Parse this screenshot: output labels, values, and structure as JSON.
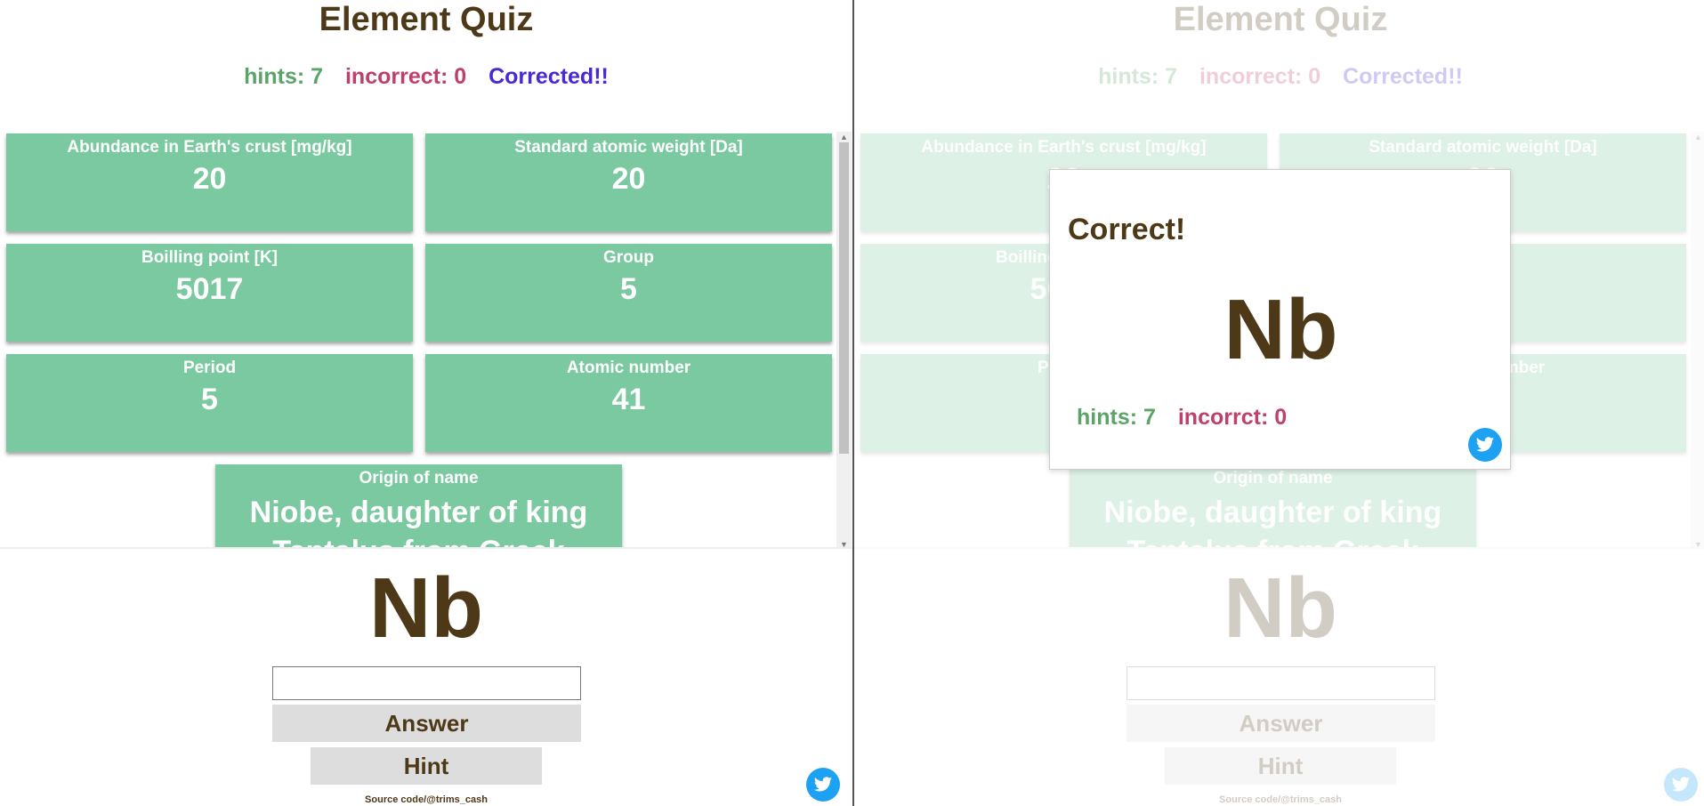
{
  "app": {
    "title": "Element Quiz",
    "hints_text": "hints: 7",
    "incorrect_text": "incorrect: 0",
    "status_text": "Corrected!!",
    "colors": {
      "card": "#7bc9a0",
      "text": "#4d3817",
      "hints": "#5aa468",
      "incorrect": "#c0406d",
      "status": "#4a28d4",
      "twitter": "#1da1f2"
    }
  },
  "cards": [
    {
      "label": "Abundance in Earth's crust [mg/kg]",
      "value": "20"
    },
    {
      "label": "Standard atomic weight [Da]",
      "value": "20"
    },
    {
      "label": "Boilling point [K]",
      "value": "5017"
    },
    {
      "label": "Group",
      "value": "5"
    },
    {
      "label": "Period",
      "value": "5"
    },
    {
      "label": "Atomic number",
      "value": "41"
    },
    {
      "label": "Origin of name",
      "value": "Niobe, daughter of king Tantalus from Greek"
    }
  ],
  "symbol": "Nb",
  "answer_input": {
    "value": "",
    "placeholder": ""
  },
  "answer_button": "Answer",
  "hint_button": "Hint",
  "source": "Source code/@trims_cash",
  "icons": {
    "twitter": "twitter-icon"
  },
  "modal": {
    "title": "Correct!",
    "symbol": "Nb",
    "hints_text": "hints: 7",
    "incorrect_text": "incorrct: 0"
  }
}
